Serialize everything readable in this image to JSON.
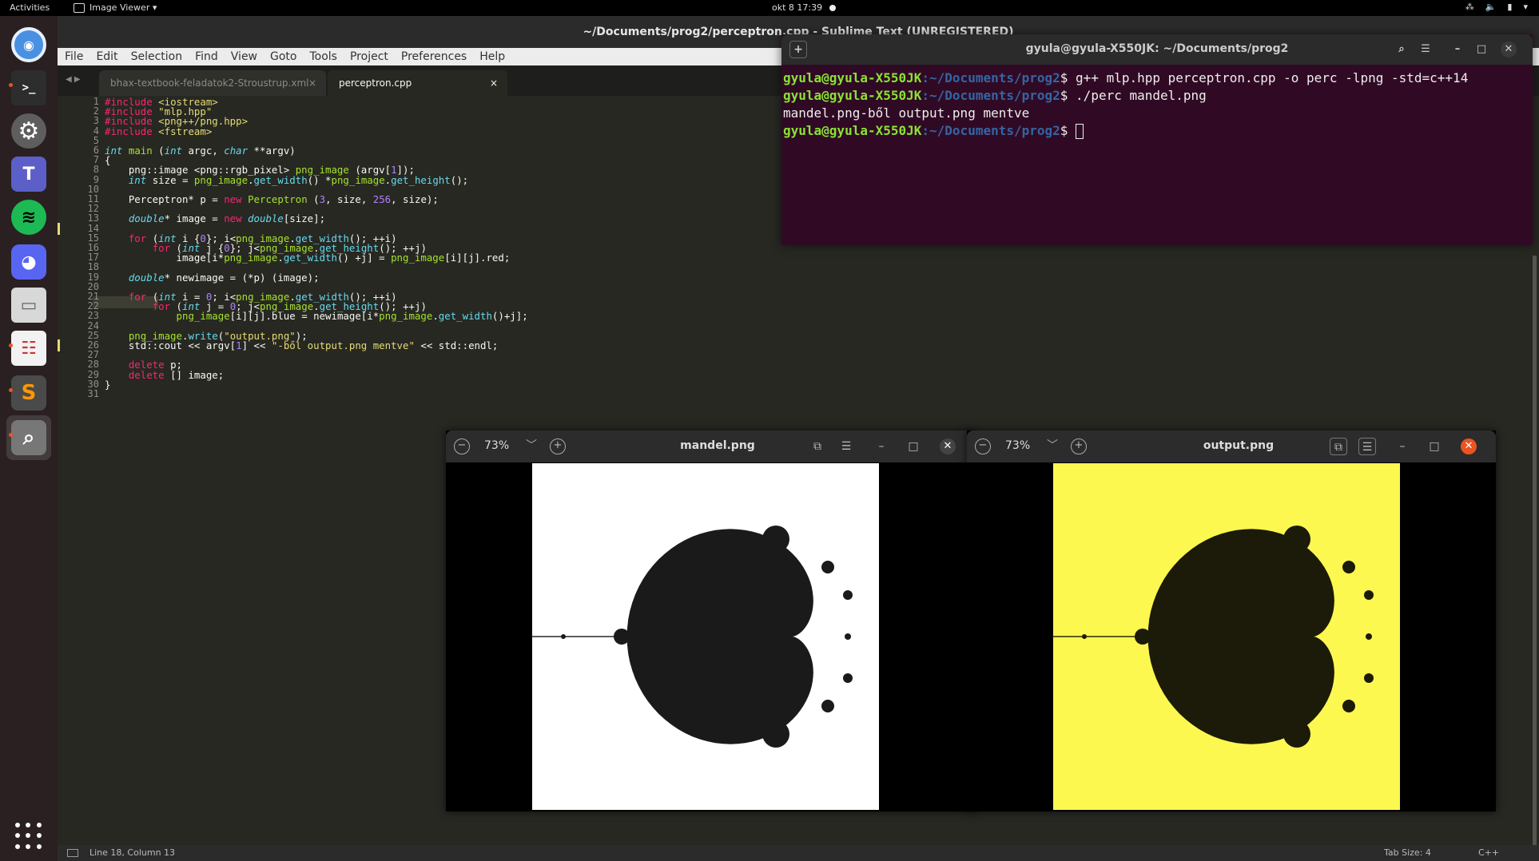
{
  "topbar": {
    "activities": "Activities",
    "app_name": "Image Viewer ▾",
    "clock": "okt 8  17:39",
    "tray": [
      "⁂",
      "🔈",
      "▮",
      "▾"
    ]
  },
  "dock": {
    "items": [
      {
        "icon": "chromium-icon",
        "label": "",
        "glyph": "◉",
        "color": "#4a90e2"
      },
      {
        "icon": "terminal-icon",
        "label": "",
        "glyph": ">_",
        "color": "#2d2d2d"
      },
      {
        "icon": "settings-icon",
        "label": "",
        "glyph": "⚙",
        "color": "#777"
      },
      {
        "icon": "teams-icon",
        "label": "",
        "glyph": "T",
        "color": "#5b5fc7"
      },
      {
        "icon": "spotify-icon",
        "label": "",
        "glyph": "≋",
        "color": "#1db954"
      },
      {
        "icon": "discord-icon",
        "label": "",
        "glyph": "◕",
        "color": "#5865f2"
      },
      {
        "icon": "files-icon",
        "label": "",
        "glyph": "▭",
        "color": "#ddd"
      },
      {
        "icon": "document-viewer-icon",
        "label": "",
        "glyph": "☷",
        "color": "#eee"
      },
      {
        "icon": "sublime-text-icon",
        "label": "",
        "glyph": "S",
        "color": "#ff9800"
      },
      {
        "icon": "image-viewer-icon",
        "label": "",
        "glyph": "⌕",
        "color": "#aaa"
      }
    ]
  },
  "sublime": {
    "title": "~/Documents/prog2/perceptron.cpp - Sublime Text (UNREGISTERED)",
    "menu": [
      "File",
      "Edit",
      "Selection",
      "Find",
      "View",
      "Goto",
      "Tools",
      "Project",
      "Preferences",
      "Help"
    ],
    "tabs": [
      {
        "label": "bhax-textbook-feladatok2-Stroustrup.xml",
        "close": "×"
      },
      {
        "label": "perceptron.cpp",
        "close": "×"
      }
    ],
    "tab_nav": "◀ ▶",
    "line_numbers": [
      "1",
      "2",
      "3",
      "4",
      "5",
      "6",
      "7",
      "8",
      "9",
      "10",
      "11",
      "12",
      "13",
      "14",
      "15",
      "16",
      "17",
      "18",
      "19",
      "20",
      "21",
      "22",
      "23",
      "24",
      "25",
      "26",
      "27",
      "28",
      "29",
      "30",
      "31"
    ],
    "code_lines": [
      "#include <iostream>",
      "#include \"mlp.hpp\"",
      "#include <png++/png.hpp>",
      "#include <fstream>",
      "",
      "int main (int argc, char **argv)",
      "{",
      "    png::image <png::rgb_pixel> png_image (argv[1]);",
      "    int size = png_image.get_width() *png_image.get_height();",
      "",
      "    Perceptron* p = new Perceptron (3, size, 256, size);",
      "",
      "    double* image = new double[size];",
      "",
      "    for (int i {0}; i<png_image.get_width(); ++i)",
      "        for (int j {0}; j<png_image.get_height(); ++j)",
      "            image[i*png_image.get_width() +j] = png_image[i][j].red;",
      "",
      "    double* newimage = (*p) (image);",
      "",
      "    for (int i = 0; i<png_image.get_width(); ++i)",
      "        for (int j = 0; j<png_image.get_height(); ++j)",
      "            png_image[i][j].blue = newimage[i*png_image.get_width()+j];",
      "",
      "    png_image.write(\"output.png\");",
      "    std::cout << argv[1] << \"-ből output.png mentve\" << std::endl;",
      "",
      "    delete p;",
      "    delete [] image;",
      "}",
      ""
    ],
    "status": {
      "position": "Line 18, Column 13",
      "tab_size": "Tab Size: 4",
      "syntax": "C++"
    }
  },
  "terminal": {
    "title": "gyula@gyula-X550JK: ~/Documents/prog2",
    "prompt_user": "gyula@gyula-X550JK",
    "prompt_path": ":~/Documents/prog2",
    "lines": [
      {
        "type": "cmd",
        "text": "$ g++ mlp.hpp perceptron.cpp -o perc -lpng -std=c++14"
      },
      {
        "type": "cmd",
        "text": "$ ./perc mandel.png"
      },
      {
        "type": "out",
        "text": "mandel.png-ből output.png mentve"
      },
      {
        "type": "cmd",
        "text": "$ "
      }
    ]
  },
  "viewers": [
    {
      "title": "mandel.png",
      "zoom": "73%",
      "bg_color": "#ffffff",
      "set_color": "#1a1a1a"
    },
    {
      "title": "output.png",
      "zoom": "73%",
      "bg_color": "#fdf850",
      "set_color": "#1c1a08"
    }
  ]
}
